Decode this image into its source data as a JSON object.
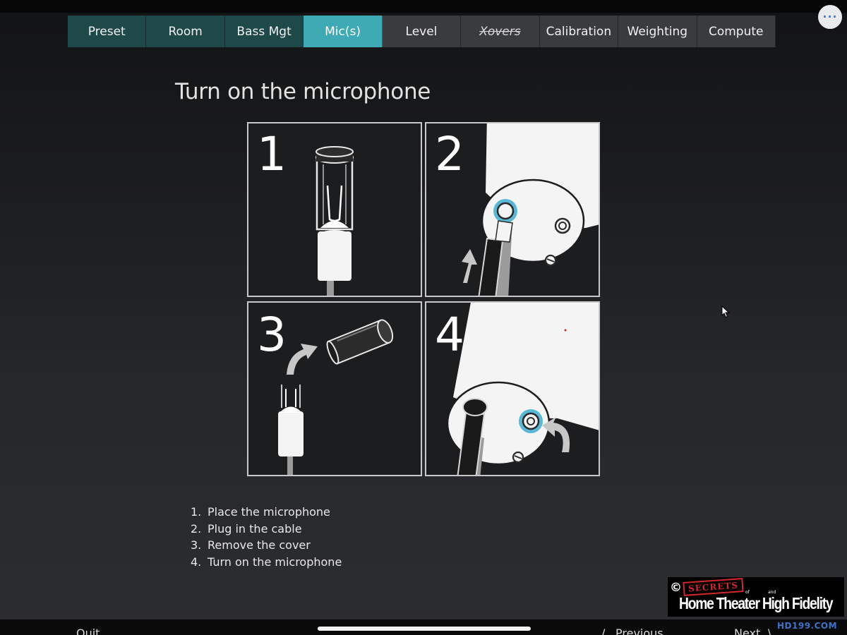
{
  "tabs": [
    {
      "label": "Preset",
      "state": "done"
    },
    {
      "label": "Room",
      "state": "done"
    },
    {
      "label": "Bass Mgt",
      "state": "done"
    },
    {
      "label": "Mic(s)",
      "state": "active"
    },
    {
      "label": "Level",
      "state": "pending"
    },
    {
      "label": "Xovers",
      "state": "disabled"
    },
    {
      "label": "Calibration",
      "state": "pending"
    },
    {
      "label": "Weighting",
      "state": "pending"
    },
    {
      "label": "Compute",
      "state": "pending"
    }
  ],
  "more_button": {
    "icon": "ellipsis-icon",
    "glyph": "···"
  },
  "page": {
    "title": "Turn on the microphone"
  },
  "figure": {
    "panels": [
      {
        "number": "1"
      },
      {
        "number": "2"
      },
      {
        "number": "3"
      },
      {
        "number": "4"
      }
    ]
  },
  "steps": [
    {
      "num": "1.",
      "text": "Place the microphone"
    },
    {
      "num": "2.",
      "text": "Plug in the cable"
    },
    {
      "num": "3.",
      "text": "Remove the cover"
    },
    {
      "num": "4.",
      "text": "Turn on the microphone"
    }
  ],
  "footer": {
    "quit": "Quit",
    "previous": "Previous",
    "next": "Next",
    "prev_chevron": "/",
    "next_chevron": "\\"
  },
  "watermark": {
    "copyright": "©",
    "secrets": "SECRETS",
    "of": "of",
    "and": "and",
    "main": "Home Theater High Fidelity",
    "url": "HD199.COM"
  },
  "colors": {
    "active_tab": "#3fa9b4",
    "done_tab": "#1f4849",
    "pending_tab": "#393b3e",
    "highlight_ring": "#5ab8d6"
  }
}
